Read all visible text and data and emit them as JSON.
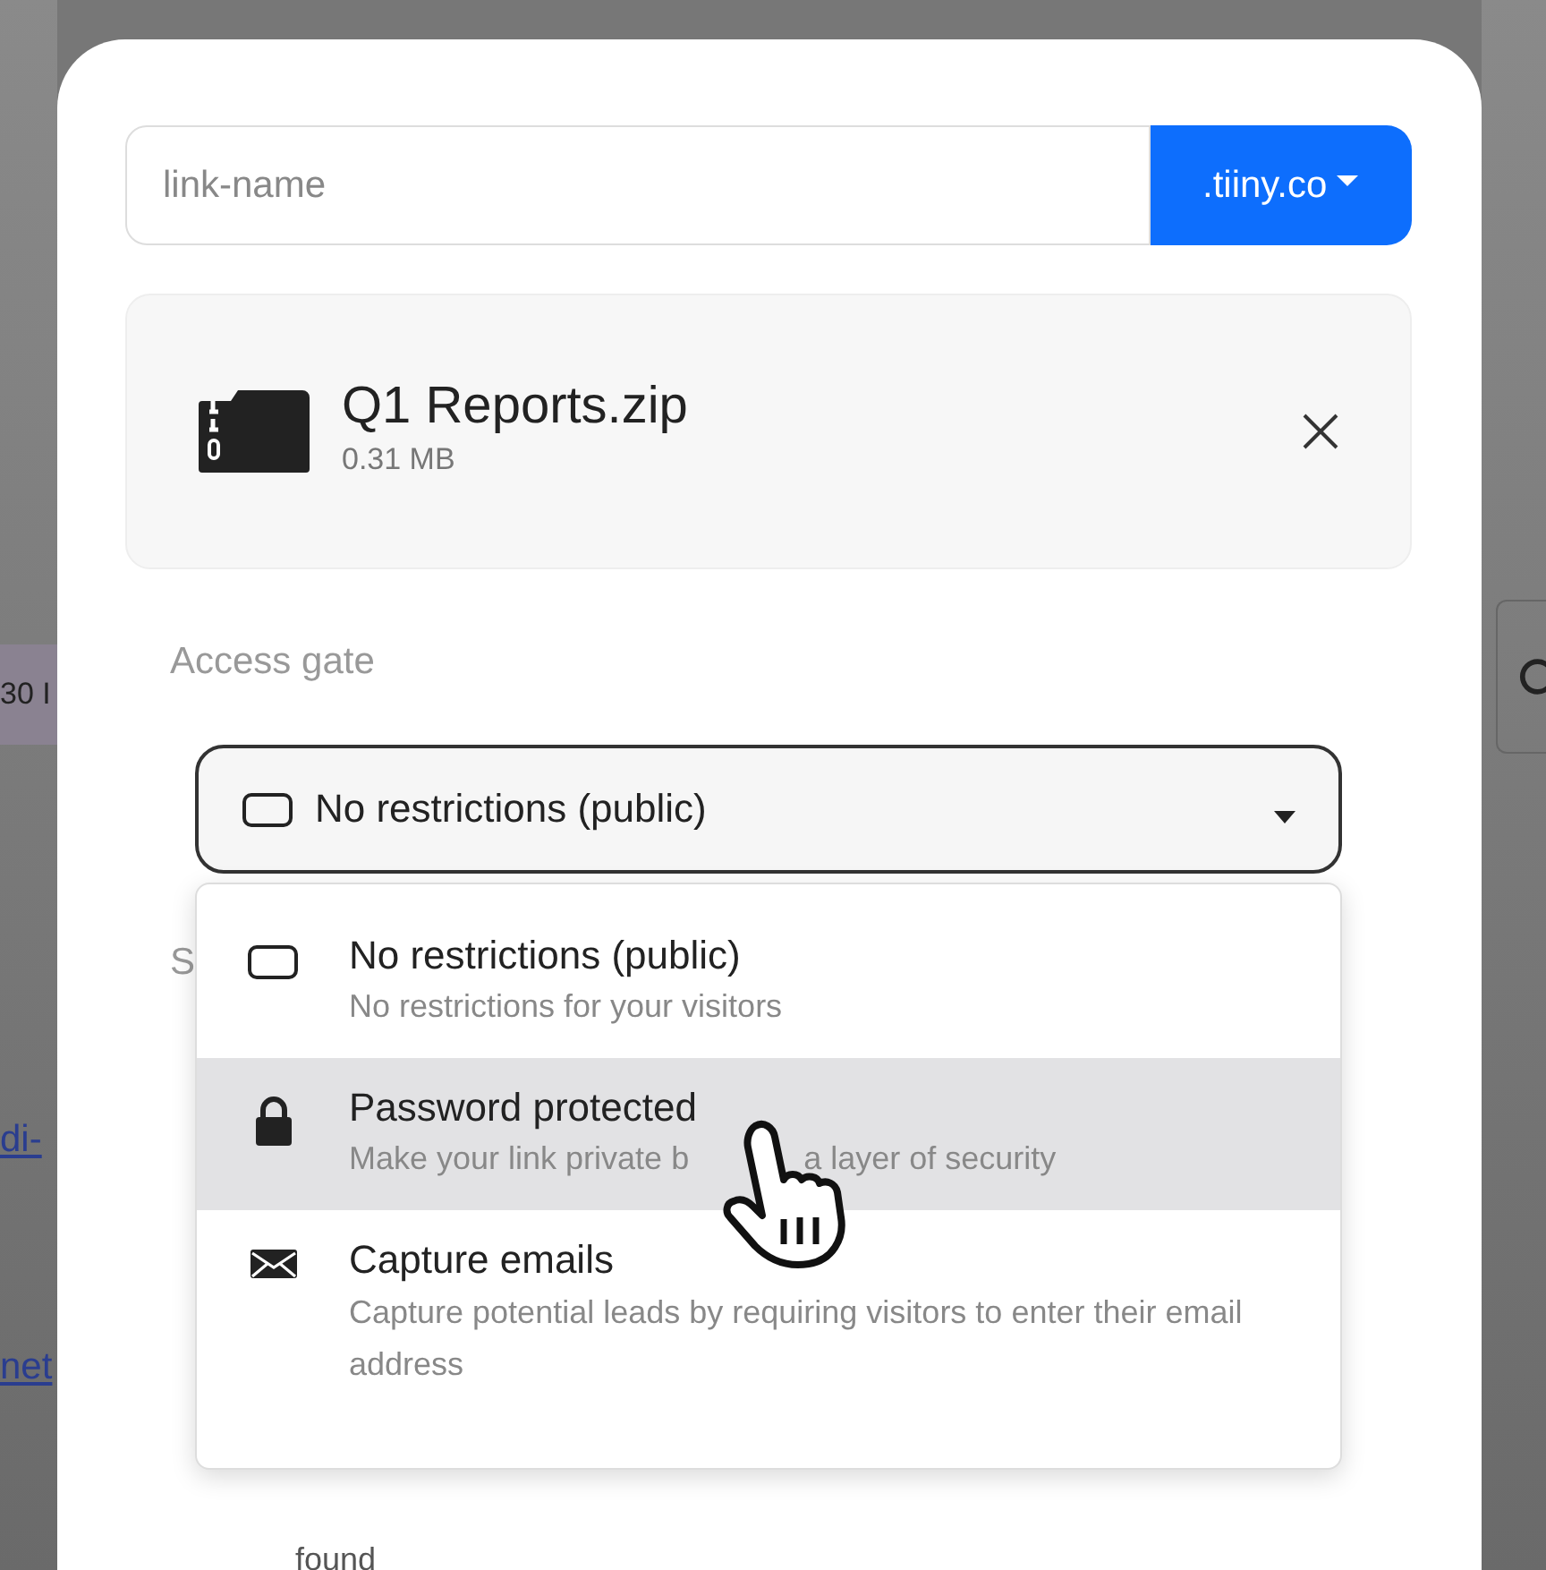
{
  "background_page": {
    "badge": "30 I",
    "links": [
      "di-",
      "net"
    ]
  },
  "link_field": {
    "placeholder": "link-name",
    "domain_button": ".tiiny.co"
  },
  "file": {
    "name": "Q1 Reports.zip",
    "size": "0.31 MB"
  },
  "access_gate": {
    "label": "Access gate",
    "value": "No restrictions (public)",
    "expanded": true,
    "options": [
      {
        "kind": "public",
        "title": "No restrictions (public)",
        "description": [
          "No restrictions for your visitors"
        ],
        "highlighted": false
      },
      {
        "kind": "password",
        "title": "Password protected",
        "description": [
          "Make your link private b",
          "a layer of security"
        ],
        "highlighted": true
      },
      {
        "kind": "email",
        "title": "Capture emails",
        "description": [
          "Capture potential leads by requiring visitors to enter their email address"
        ],
        "highlighted": false
      }
    ]
  },
  "next_section": {
    "label": "S",
    "hint": "found"
  }
}
